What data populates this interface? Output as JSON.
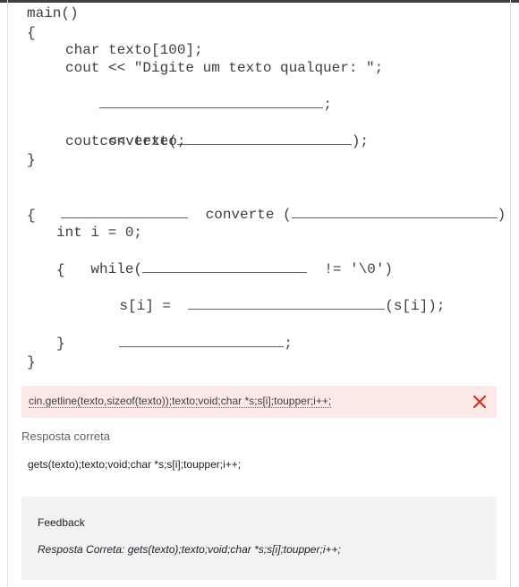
{
  "code_lines": {
    "l1": "main()",
    "l2": "{",
    "l3": "char texto[100];",
    "l4": "cout << \"Digite um texto qualquer: \";",
    "l5_tail": ";",
    "l6_head": "converte(",
    "l6_tail": ");",
    "l7": "cout << texto;",
    "l8": "}",
    "l9_mid": "converte (",
    "l9_tail": ")",
    "l10": "{",
    "l11": "int i = 0;",
    "l12_head": "while(",
    "l12_tail": "!= '\\0')",
    "l13": "{",
    "l14_head": "s[i] =",
    "l14_tail": "(s[i]);",
    "l15_tail": ";",
    "l16": "}",
    "l17": "}"
  },
  "answer": {
    "text": "cin.getline(texto,sizeof(texto));texto;void;char *s;s[i];toupper;i++;",
    "status_color": "#d93025"
  },
  "correct": {
    "label": "Resposta correta",
    "text": "gets(texto);texto;void;char *s;s[i];toupper;i++;"
  },
  "feedback": {
    "title": "Feedback",
    "text": "Resposta Correta: gets(texto);texto;void;char *s;s[i];toupper;i++;"
  }
}
